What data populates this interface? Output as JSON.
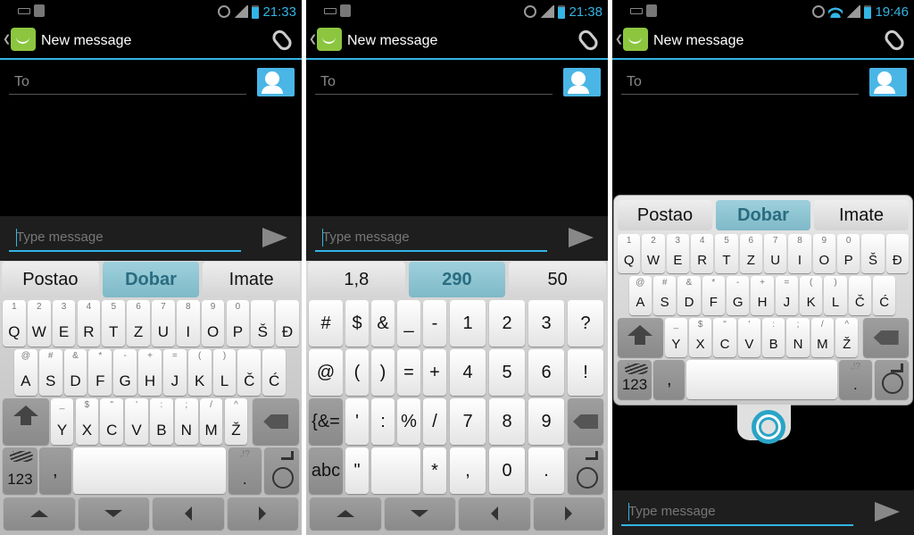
{
  "panels": [
    {
      "clock": "21:33",
      "title": "New message",
      "to_placeholder": "To",
      "message_placeholder": "Type message",
      "suggestions": [
        "Postao",
        "Dobar",
        "Imate"
      ]
    },
    {
      "clock": "21:38",
      "title": "New message",
      "to_placeholder": "To",
      "message_placeholder": "Type message",
      "suggestions": [
        "1,8",
        "290",
        "50"
      ]
    },
    {
      "clock": "19:46",
      "title": "New message",
      "to_placeholder": "To",
      "message_placeholder": "Type message",
      "suggestions": [
        "Postao",
        "Dobar",
        "Imate"
      ]
    }
  ],
  "alpha_rows": [
    [
      {
        "m": "Q",
        "s": "1"
      },
      {
        "m": "W",
        "s": "2"
      },
      {
        "m": "E",
        "s": "3"
      },
      {
        "m": "R",
        "s": "4"
      },
      {
        "m": "T",
        "s": "5"
      },
      {
        "m": "Z",
        "s": "6"
      },
      {
        "m": "U",
        "s": "7"
      },
      {
        "m": "I",
        "s": "8"
      },
      {
        "m": "O",
        "s": "9"
      },
      {
        "m": "P",
        "s": "0"
      },
      {
        "m": "Š",
        "s": ""
      },
      {
        "m": "Đ",
        "s": ""
      }
    ],
    [
      {
        "m": "A",
        "s": "@"
      },
      {
        "m": "S",
        "s": "#"
      },
      {
        "m": "D",
        "s": "&"
      },
      {
        "m": "F",
        "s": "*"
      },
      {
        "m": "G",
        "s": "-"
      },
      {
        "m": "H",
        "s": "+"
      },
      {
        "m": "J",
        "s": "="
      },
      {
        "m": "K",
        "s": "("
      },
      {
        "m": "L",
        "s": ")"
      },
      {
        "m": "Č",
        "s": ""
      },
      {
        "m": "Ć",
        "s": ""
      }
    ],
    [
      {
        "m": "Y",
        "s": "_"
      },
      {
        "m": "X",
        "s": "$"
      },
      {
        "m": "C",
        "s": "\""
      },
      {
        "m": "V",
        "s": "'"
      },
      {
        "m": "B",
        "s": ":"
      },
      {
        "m": "N",
        "s": ";"
      },
      {
        "m": "M",
        "s": "/"
      },
      {
        "m": "Ž",
        "s": "^"
      }
    ]
  ],
  "alpha_bottom": {
    "num_label": "123",
    "comma": ",",
    "period": ".",
    "period_sub": ",!?"
  },
  "sym_rows": [
    [
      "#",
      "$",
      "&",
      "_",
      "-",
      "1",
      "2",
      "3",
      "?"
    ],
    [
      "@",
      "(",
      ")",
      "=",
      "+",
      "4",
      "5",
      "6",
      "!"
    ],
    [
      "{&=",
      "'",
      ":",
      "%",
      "/",
      "7",
      "8",
      "9"
    ],
    [
      "abc",
      "\"",
      "",
      "*",
      ",",
      "0",
      "."
    ]
  ],
  "colors": {
    "accent": "#33b5e5",
    "suggest_mid": "#8ec5d3"
  }
}
